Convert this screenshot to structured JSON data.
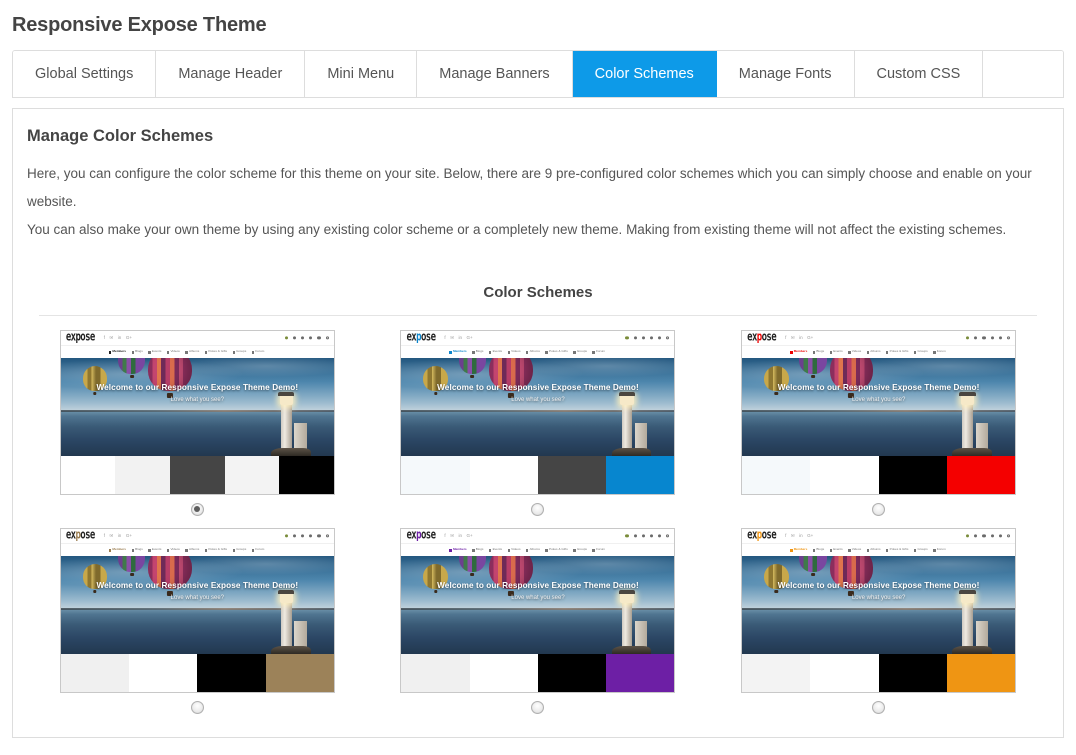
{
  "page": {
    "title": "Responsive Expose Theme"
  },
  "tabs": [
    {
      "label": "Global Settings",
      "active": false
    },
    {
      "label": "Manage Header",
      "active": false
    },
    {
      "label": "Mini Menu",
      "active": false
    },
    {
      "label": "Manage Banners",
      "active": false
    },
    {
      "label": "Color Schemes",
      "active": true
    },
    {
      "label": "Manage Fonts",
      "active": false
    },
    {
      "label": "Custom CSS",
      "active": false
    }
  ],
  "active_tab_color": "#0d9ae8",
  "panel": {
    "title": "Manage Color Schemes",
    "paragraphs": [
      "Here, you can configure the color scheme for this theme on your site. Below, there are 9 pre-configured color schemes which you can simply choose and enable on your website.",
      "You can also make your own theme by using any existing color scheme or a completely new theme. Making from existing theme will not affect the existing schemes."
    ],
    "section_heading": "Color Schemes"
  },
  "preview": {
    "logo": "expose",
    "social_icons": [
      "facebook-icon",
      "twitter-icon",
      "linkedin-icon",
      "google-plus-icon"
    ],
    "utility_icons": [
      "globe-icon",
      "user-icon",
      "message-icon",
      "bell-icon",
      "gear-icon",
      "search-icon"
    ],
    "nav_items": [
      "Members",
      "Blogs",
      "Events",
      "Videos",
      "Albums",
      "Pokes & Gifts",
      "Groups",
      "Forum"
    ],
    "banner_title": "Welcome to our Responsive Expose Theme Demo!",
    "banner_subtitle": "Love what you see?"
  },
  "schemes": [
    {
      "name": "scheme-1",
      "selected": true,
      "accent": "#222222",
      "logo_accent": "#222222",
      "swatches": [
        "#ffffff",
        "#f2f2f2",
        "#454545",
        "#f3f3f3",
        "#000000"
      ]
    },
    {
      "name": "scheme-2",
      "selected": false,
      "accent": "#0d86cc",
      "logo_accent": "#0d86cc",
      "swatches": [
        "#f5f9fb",
        "#ffffff",
        "#454545",
        "#0786cf"
      ]
    },
    {
      "name": "scheme-3",
      "selected": false,
      "accent": "#ee0000",
      "logo_accent": "#ee0000",
      "swatches": [
        "#f5f9fb",
        "#ffffff",
        "#000000",
        "#f40000"
      ]
    },
    {
      "name": "scheme-4",
      "selected": false,
      "accent": "#9a7d50",
      "logo_accent": "#9a7d50",
      "swatches": [
        "#f0f0f0",
        "#ffffff",
        "#000000",
        "#9c8259"
      ]
    },
    {
      "name": "scheme-5",
      "selected": false,
      "accent": "#6d1fa5",
      "logo_accent": "#6d1fa5",
      "swatches": [
        "#f0f0f0",
        "#ffffff",
        "#000000",
        "#6d1fa5"
      ]
    },
    {
      "name": "scheme-6",
      "selected": false,
      "accent": "#ef9513",
      "logo_accent": "#ef9513",
      "swatches": [
        "#f3f3f3",
        "#ffffff",
        "#000000",
        "#ef9513"
      ]
    }
  ]
}
